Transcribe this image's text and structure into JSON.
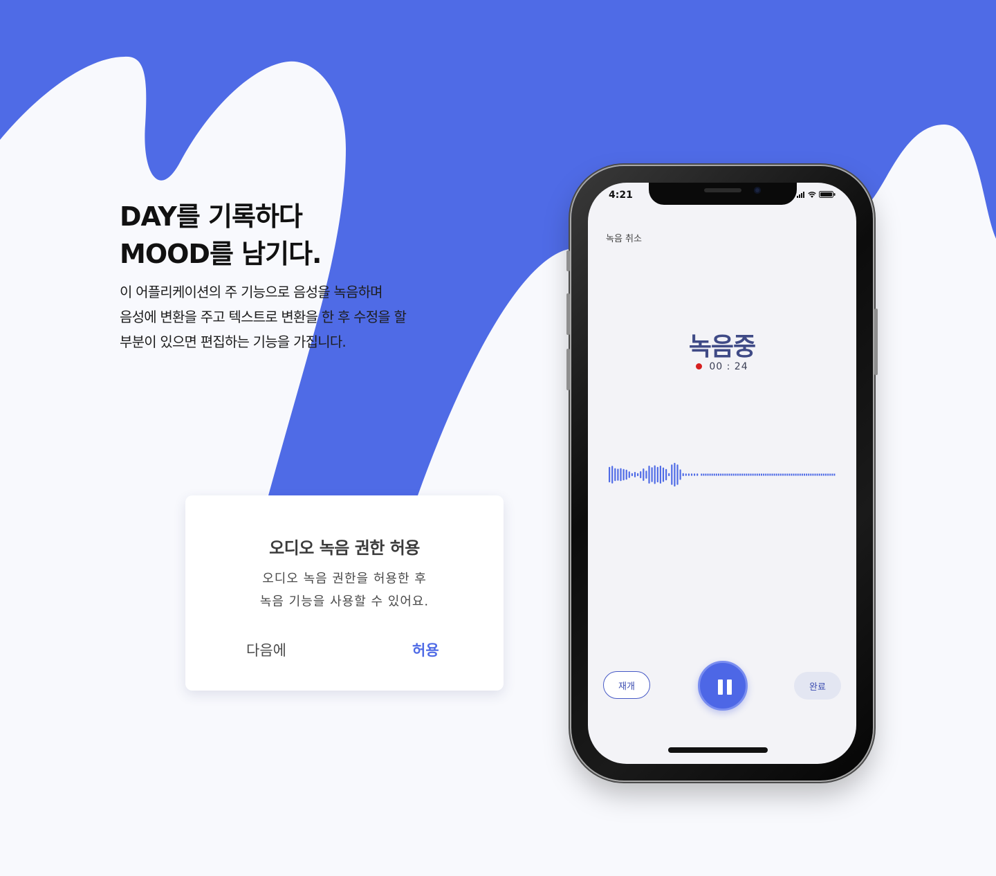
{
  "colors": {
    "accent_blue": "#4f6be6",
    "page_background": "#f8f9fd",
    "record_red": "#d61f1f",
    "title_navy": "#3f4a86"
  },
  "hero": {
    "headline_line1": "DAY를 기록하다",
    "headline_line2": "MOOD를 남기다.",
    "description_lines": [
      "이 어플리케이션의 주 기능으로 음성을 녹음하며",
      "음성에 변환을 주고 텍스트로 변환을 한 후 수정을 할",
      "부분이 있으면 편집하는 기능을 가집니다."
    ]
  },
  "permission_dialog": {
    "title": "오디오 녹음 권한 허용",
    "body_lines": [
      "오디오 녹음 권한을 허용한 후",
      "녹음 기능을 사용할 수 있어요."
    ],
    "later_label": "다음에",
    "allow_label": "허용"
  },
  "phone": {
    "status_time": "4:21",
    "status_icons": [
      "signal-icon",
      "wifi-icon",
      "battery-icon"
    ],
    "cancel_label": "녹음 취소",
    "recording_title": "녹음중",
    "timer": "00 : 24",
    "waveform_amplitudes": [
      0.62,
      0.71,
      0.52,
      0.48,
      0.52,
      0.46,
      0.4,
      0.26,
      0.12,
      0.22,
      0.12,
      0.28,
      0.5,
      0.32,
      0.72,
      0.6,
      0.75,
      0.62,
      0.72,
      0.58,
      0.46,
      0.12,
      0.82,
      0.95,
      0.82,
      0.42,
      0.12,
      0.1,
      0.1,
      0.1,
      0.1,
      0.1
    ],
    "resume_label": "재개",
    "pause_icon": "pause-icon",
    "done_label": "완료"
  }
}
